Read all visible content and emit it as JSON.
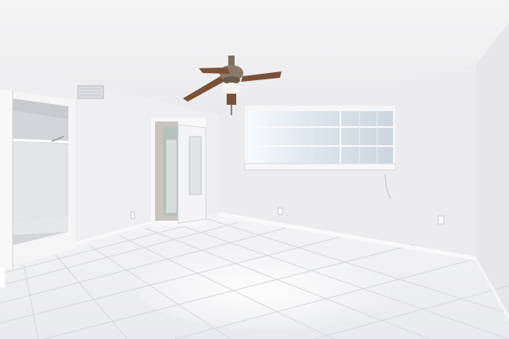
{
  "scene": {
    "colors": {
      "ceiling": "#f1f1f2",
      "left_wall": "#eeeef0",
      "back_wall": "#ececee",
      "right_wall": "#e8e8ea",
      "floor": "#f3f3f5",
      "grout": "#d6d6d9",
      "trim": "#f9f9fa",
      "closet_shadow": "#cfd0d3",
      "window_glass": "#d9e2ea",
      "fan_metal": "#8a7a68",
      "fan_blade": "#7a5138"
    },
    "elements": {
      "ceiling_fan": "ceiling-fan",
      "air_vent": "air-vent",
      "window": "window",
      "closet": "closet-doorway",
      "bathroom_door": "bathroom-doorway",
      "floor": "tile-floor"
    }
  }
}
